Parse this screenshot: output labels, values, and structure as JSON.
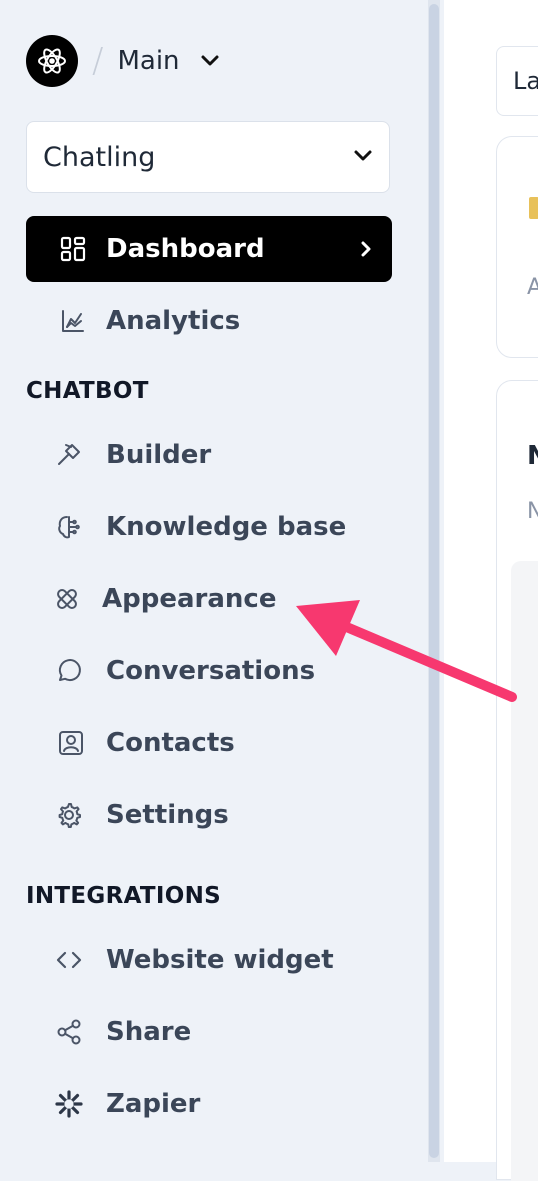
{
  "workspace": {
    "name": "Main"
  },
  "chatbot_select": {
    "value": "Chatling"
  },
  "nav": {
    "dashboard": "Dashboard",
    "analytics": "Analytics",
    "section_chatbot": "CHATBOT",
    "builder": "Builder",
    "knowledge_base": "Knowledge base",
    "appearance": "Appearance",
    "conversations": "Conversations",
    "contacts": "Contacts",
    "settings": "Settings",
    "section_integrations": "INTEGRATIONS",
    "website_widget": "Website widget",
    "share": "Share",
    "zapier": "Zapier"
  },
  "main": {
    "select_partial": "La",
    "card1_partial": "A",
    "card2_title_partial": "N",
    "card2_sub_partial": "N"
  },
  "annotation": {
    "arrow_color": "#f7386f"
  }
}
